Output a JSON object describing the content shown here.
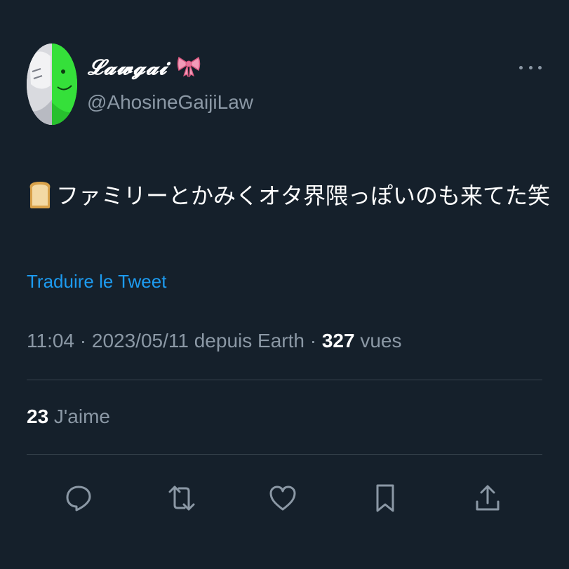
{
  "user": {
    "display_name": "𝓛𝓪𝔀𝓰𝓪𝓲",
    "display_emoji": "ribbon",
    "handle": "@AhosineGaijiLaw"
  },
  "tweet": {
    "emoji": "bread",
    "text": "ファミリーとかみくオタ界隈っぽいのも来てた笑",
    "translate_link": "Traduire le Tweet"
  },
  "meta": {
    "time": "11:04",
    "separator1": " · ",
    "date": "2023/05/11",
    "source": " depuis Earth",
    "separator2": " · ",
    "views_count": "327",
    "views_label": " vues"
  },
  "stats": {
    "likes_count": "23",
    "likes_label": " J'aime"
  },
  "actions": [
    "reply-icon",
    "retweet-icon",
    "like-icon",
    "bookmark-icon",
    "share-icon"
  ],
  "colors": {
    "background": "#15202b",
    "link": "#1d9bf0",
    "secondary_text": "#8b98a5",
    "divider": "#38444d"
  }
}
